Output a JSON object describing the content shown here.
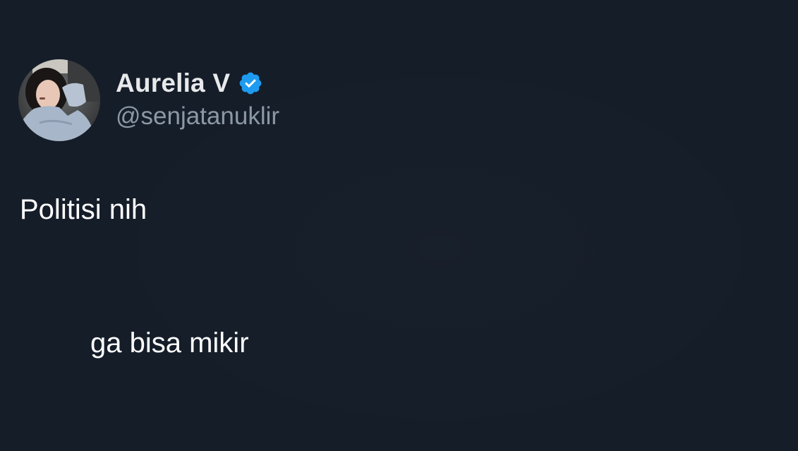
{
  "author": {
    "display_name": "Aurelia V",
    "handle": "@senjatanuklir",
    "verified": true,
    "avatar_icon": "profile-photo"
  },
  "tweet": {
    "lines": [
      "Politisi nih",
      "ga bisa mikir"
    ]
  },
  "colors": {
    "background": "#151d29",
    "text_primary": "#ffffff",
    "text_name": "#e7e9ea",
    "text_secondary": "#8b98a5",
    "verified_badge": "#1d9bf0"
  }
}
